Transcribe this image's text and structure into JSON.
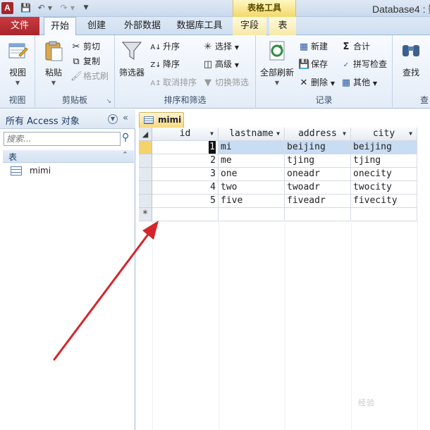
{
  "title_bar": {
    "app_icon_text": "A",
    "contextual_tab_group": "表格工具",
    "window_title": "Database4 : 数"
  },
  "tabs": {
    "file": "文件",
    "home": "开始",
    "create": "创建",
    "external_data": "外部数据",
    "database_tools": "数据库工具",
    "fields": "字段",
    "table": "表"
  },
  "ribbon": {
    "views": {
      "view_button": "视图",
      "group_label": "视图"
    },
    "clipboard": {
      "paste": "粘贴",
      "cut": "剪切",
      "copy": "复制",
      "format_painter": "格式刷",
      "group_label": "剪贴板"
    },
    "sort_filter": {
      "filter": "筛选器",
      "ascending": "升序",
      "descending": "降序",
      "remove_sort": "取消排序",
      "selection": "选择",
      "advanced": "高级",
      "toggle_filter": "切换筛选",
      "group_label": "排序和筛选"
    },
    "records": {
      "refresh_all": "全部刷新",
      "new": "新建",
      "save": "保存",
      "delete": "删除",
      "totals": "合计",
      "spelling": "拼写检查",
      "more": "其他",
      "group_label": "记录"
    },
    "find": {
      "find_button": "查找",
      "group_label": "查"
    }
  },
  "nav_pane": {
    "title": "所有 Access 对象",
    "search_placeholder": "搜索...",
    "group_label": "表",
    "items": [
      {
        "label": "mimi"
      }
    ]
  },
  "document": {
    "tab_label": "mimi",
    "columns": [
      "id",
      "lastname",
      "address",
      "city"
    ],
    "rows": [
      {
        "id": "1",
        "lastname": "mi",
        "address": "beijing",
        "city": "beijing"
      },
      {
        "id": "2",
        "lastname": "me",
        "address": "tjing",
        "city": "tjing"
      },
      {
        "id": "3",
        "lastname": "one",
        "address": "oneadr",
        "city": "onecity"
      },
      {
        "id": "4",
        "lastname": "two",
        "address": "twoadr",
        "city": "twocity"
      },
      {
        "id": "5",
        "lastname": "five",
        "address": "fiveadr",
        "city": "fivecity"
      }
    ],
    "new_record_marker": "*"
  },
  "watermark_text": "经验",
  "colors": {
    "file_tab": "#b02e33",
    "contextual_tab": "#f2d96a",
    "selected_row": "#c8dcf3",
    "arrow": "#d4252b"
  }
}
